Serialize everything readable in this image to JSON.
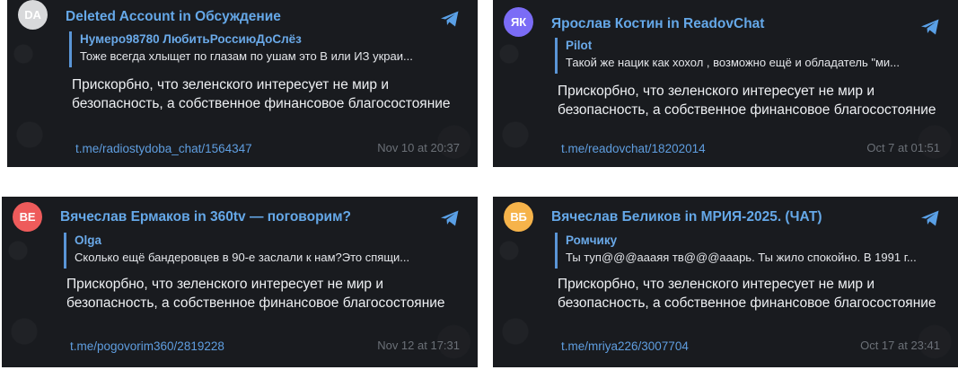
{
  "colors": {
    "card_bg": "#191b1f",
    "accent": "#65a8e8",
    "link": "#5f9ee0",
    "timestamp": "#6b7077",
    "text": "#eef0f3"
  },
  "cards": [
    {
      "avatar_initials": "DA",
      "avatar_color": "#d8d9db",
      "header": "Deleted Account in Обсуждение",
      "quote_author": "Нумеро98780 ЛюбитьРоссиюДоСлёз",
      "quote_text": "Тоже всегда хлыщет по глазам по ушам это В или ИЗ украи...",
      "message": "Прискорбно, что зеленского интересует не мир и безопасность, а собственное финансовое благосостояние",
      "link": "t.me/radiostydoba_chat/1564347",
      "time": "Nov 10 at 20:37",
      "icon": "telegram-icon"
    },
    {
      "avatar_initials": "ЯК",
      "avatar_color": "#7b6cf6",
      "header": "Ярослав Костин in ReadovChat",
      "quote_author": "Pilot",
      "quote_text": "Такой же нацик как хохол , возможно ещё и обладатель \"ми...",
      "message": "Прискорбно, что зеленского интересует не мир и безопасность, а собственное финансовое благосостояние",
      "link": "t.me/readovchat/18202014",
      "time": "Oct 7 at 01:51",
      "icon": "telegram-icon"
    },
    {
      "avatar_initials": "ВЕ",
      "avatar_color": "#ee5b5b",
      "header": "Вячеслав Ермаков in 360tv — поговорим?",
      "quote_author": "Olga",
      "quote_text": "Сколько ещё бандеровцев в 90-е заслали к нам?Это спящи...",
      "message": "Прискорбно, что зеленского интересует не мир и безопасность, а собственное финансовое благосостояние",
      "link": "t.me/pogovorim360/2819228",
      "time": "Nov 12 at 17:31",
      "icon": "telegram-icon"
    },
    {
      "avatar_initials": "ВБ",
      "avatar_color": "#f6b34a",
      "header": "Вячеслав Беликов in МРИЯ-2025. (ЧАТ)",
      "quote_author": "Ромчику",
      "quote_text": "Ты туп@@@аааяя тв@@@ааарь. Ты жило спокойно. В 1991 г...",
      "message": "Прискорбно, что зеленского интересует не мир и безопасность, а собственное финансовое благосостояние",
      "link": "t.me/mriya226/3007704",
      "time": "Oct 17 at 23:41",
      "icon": "telegram-icon"
    }
  ]
}
